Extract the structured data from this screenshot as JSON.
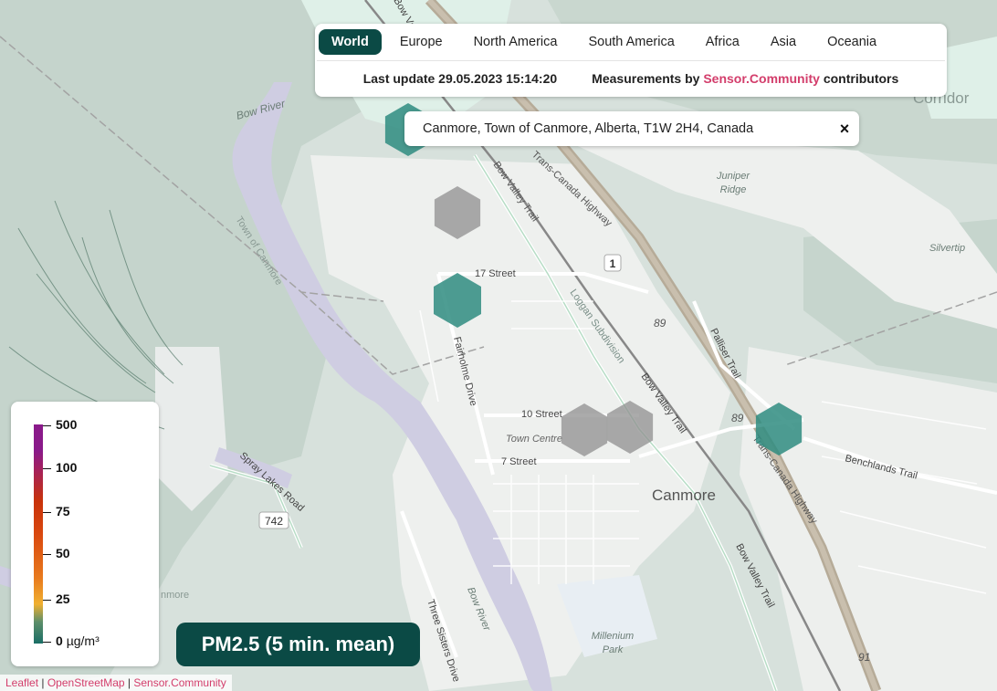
{
  "map": {
    "place_labels": {
      "bow_river_north": "Bow River",
      "bow_river_south": "Bow River",
      "corridor": "Corridor",
      "juniper_ridge_1": "Juniper",
      "juniper_ridge_2": "Ridge",
      "silvertip": "Silvertip",
      "canmore": "Canmore",
      "town_centre": "Town Centre",
      "millennium_1": "Millenium",
      "millennium_2": "Park",
      "town_of_canmore": "Town of Canmore",
      "canmore_west": "nmore"
    },
    "road_labels": {
      "bow_valley_trail_north": "Bow Valley Trail",
      "trans_canada_north": "Trans-Canada Highway",
      "trans_canada_south": "Trans-Canada Highway",
      "street_17": "17 Street",
      "street_10": "10 Street",
      "street_7": "7 Street",
      "fairholme": "Fairholme Drive",
      "spray_lakes": "Spray Lakes Road",
      "three_sisters": "Three Sisters Drive",
      "bow_valley_trail_mid": "Bow Valley Trail",
      "bow_valley_trail_south": "Bow Valley Trail",
      "palliser": "Palliser Trail",
      "benchlands": "Benchlands Trail",
      "logan": "Loggan Subdivision",
      "bow_valley_ne": "Bow Valley Trail"
    },
    "shields": {
      "hwy1": "1",
      "hwy89_a": "89",
      "hwy89_b": "89",
      "hwy742": "742",
      "hwy91": "91"
    },
    "sensor_hexes": [
      {
        "status": "measured",
        "color": "#2f8c80"
      },
      {
        "status": "no-data",
        "color": "#8f8f8f"
      },
      {
        "status": "measured",
        "color": "#2f8c80"
      },
      {
        "status": "no-data",
        "color": "#8f8f8f"
      },
      {
        "status": "no-data",
        "color": "#8f8f8f"
      },
      {
        "status": "measured",
        "color": "#2f8c80"
      }
    ]
  },
  "tabs": [
    {
      "label": "World",
      "active": true
    },
    {
      "label": "Europe",
      "active": false
    },
    {
      "label": "North America",
      "active": false
    },
    {
      "label": "South America",
      "active": false
    },
    {
      "label": "Africa",
      "active": false
    },
    {
      "label": "Asia",
      "active": false
    },
    {
      "label": "Oceania",
      "active": false
    }
  ],
  "status": {
    "last_update": "Last update 29.05.2023 15:14:20",
    "measurements_prefix": "Measurements by",
    "measurements_link": "Sensor.Community",
    "measurements_suffix": "contributors"
  },
  "search": {
    "value": "Canmore, Town of Canmore, Alberta, T1W 2H4, Canada",
    "close_icon": "×"
  },
  "legend": {
    "ticks": [
      "500",
      "100",
      "75",
      "50",
      "25",
      "0"
    ],
    "unit": "µg/m³"
  },
  "badge": {
    "label": "PM2.5 (5 min. mean)"
  },
  "attribution": {
    "leaflet": "Leaflet",
    "sep1": "|",
    "osm": "OpenStreetMap",
    "sep2": "|",
    "sc": "Sensor.Community"
  },
  "colors": {
    "accent": "#0b4a45",
    "link": "#d33d6b",
    "hex_measured": "#2f8c80",
    "hex_nodata": "#8f8f8f"
  }
}
